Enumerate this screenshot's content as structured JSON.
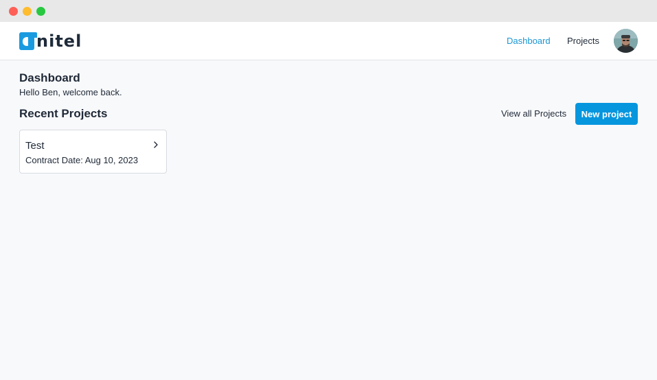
{
  "nav": {
    "brand": "anitel",
    "links": [
      {
        "label": "Dashboard",
        "active": true
      },
      {
        "label": "Projects",
        "active": false
      }
    ]
  },
  "page": {
    "title": "Dashboard",
    "welcome": "Hello Ben, welcome back."
  },
  "recent": {
    "title": "Recent Projects",
    "view_all_label": "View all Projects",
    "new_project_label": "New project",
    "projects": [
      {
        "name": "Test",
        "contract_date": "Contract Date: Aug 10, 2023"
      }
    ]
  },
  "colors": {
    "accent": "#0596de",
    "active_link": "#1a96d4"
  }
}
